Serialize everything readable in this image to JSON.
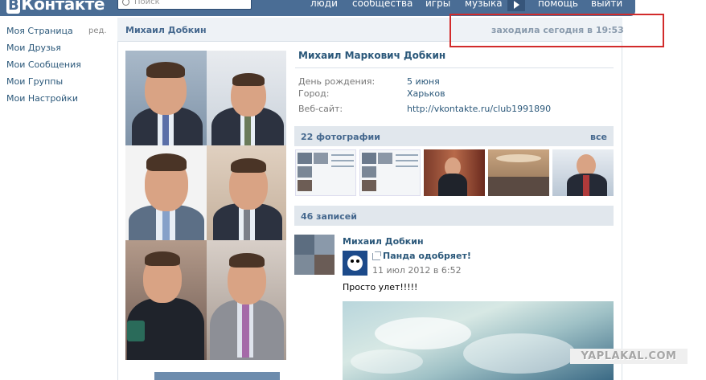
{
  "header": {
    "logo_letter": "В",
    "logo_text": "Контакте",
    "search_placeholder": "Поиск",
    "nav": [
      "люди",
      "сообщества",
      "игры",
      "музыка",
      "помощь",
      "выйти"
    ]
  },
  "sidebar": {
    "edit_label": "ред.",
    "items": [
      "Моя Страница",
      "Мои Друзья",
      "Мои Сообщения",
      "Мои Группы",
      "Мои Настройки"
    ]
  },
  "profile": {
    "page_title": "Михаил Добкин",
    "last_seen": "заходила сегодня в 19:53",
    "full_name": "Михаил Маркович Добкин",
    "fields": [
      {
        "label": "День рождения:",
        "value": "5 июня"
      },
      {
        "label": "Город:",
        "value": "Харьков"
      },
      {
        "label": "Веб-сайт:",
        "value": "http://vkontakte.ru/club1991890"
      }
    ]
  },
  "photos": {
    "title": "22 фотографии",
    "all_label": "все"
  },
  "wall": {
    "title": "46 записей",
    "post": {
      "author": "Михаил Добкин",
      "shared_from": "Панда одобряет!",
      "date": "11 июл 2012 в 6:52",
      "text": "Просто улет!!!!!"
    }
  },
  "watermark": "YAPLAKAL.COM",
  "colors": {
    "header_blue": "#4a6d95",
    "link_blue": "#2b587a",
    "section_bg": "#e1e7ed",
    "highlight_red": "#d22b2b"
  }
}
